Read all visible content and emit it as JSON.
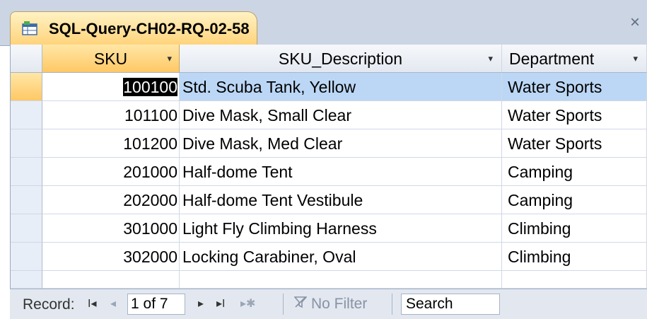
{
  "tab": {
    "title": "SQL-Query-CH02-RQ-02-58",
    "close_glyph": "×",
    "icon": "query-datasheet-icon"
  },
  "columns": [
    {
      "label": "SKU",
      "arrow": "▾"
    },
    {
      "label": "SKU_Description",
      "arrow": "▾"
    },
    {
      "label": "Department",
      "arrow": "▾"
    }
  ],
  "rows": [
    {
      "sku": "100100",
      "desc": "Std. Scuba Tank, Yellow",
      "dept": "Water Sports"
    },
    {
      "sku": "101100",
      "desc": "Dive Mask, Small Clear",
      "dept": "Water Sports"
    },
    {
      "sku": "101200",
      "desc": "Dive Mask, Med Clear",
      "dept": "Water Sports"
    },
    {
      "sku": "201000",
      "desc": "Half-dome Tent",
      "dept": "Camping"
    },
    {
      "sku": "202000",
      "desc": "Half-dome Tent Vestibule",
      "dept": "Camping"
    },
    {
      "sku": "301000",
      "desc": "Light Fly Climbing Harness",
      "dept": "Climbing"
    },
    {
      "sku": "302000",
      "desc": "Locking Carabiner, Oval",
      "dept": "Climbing"
    }
  ],
  "navigation": {
    "record_label": "Record:",
    "first_glyph": "I◂",
    "prev_glyph": "◂",
    "position": "1 of 7",
    "next_glyph": "▸",
    "last_glyph": "▸I",
    "new_glyph": "▸✱",
    "filter_label": "No Filter",
    "filter_icon": "funnel-icon",
    "search_label": "Search"
  },
  "colors": {
    "tab_accent": "#ffd37a",
    "selected_row": "#bcd7f5",
    "chrome": "#ccd5e3"
  }
}
